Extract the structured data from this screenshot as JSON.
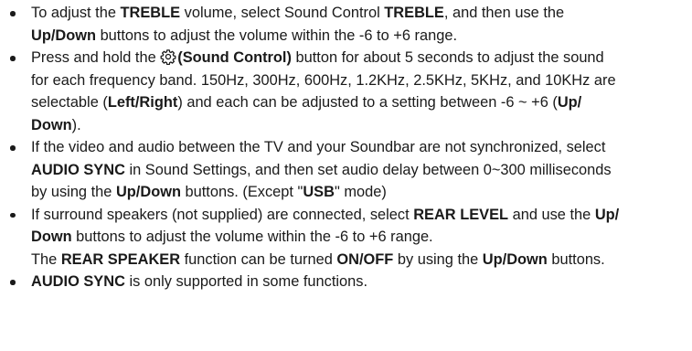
{
  "items": [
    {
      "lines": [
        [
          {
            "t": "To adjust the "
          },
          {
            "t": "TREBLE",
            "b": true
          },
          {
            "t": " volume, select Sound Control "
          },
          {
            "t": "TREBLE",
            "b": true
          },
          {
            "t": ", and then use the"
          }
        ],
        [
          {
            "t": "Up/Down",
            "b": true
          },
          {
            "t": " buttons to adjust the volume within the -6 to +6 range."
          }
        ]
      ]
    },
    {
      "lines": [
        [
          {
            "t": "Press and hold the "
          },
          {
            "icon": "gear-icon"
          },
          {
            "t": "(Sound Control)",
            "b": true
          },
          {
            "t": " button for about 5 seconds to adjust the sound"
          }
        ],
        [
          {
            "t": "for each frequency band. 150Hz, 300Hz, 600Hz, 1.2KHz, 2.5KHz, 5KHz, and 10KHz are"
          }
        ],
        [
          {
            "t": "selectable ("
          },
          {
            "t": "Left/Right",
            "b": true
          },
          {
            "t": ") and each can be adjusted to a setting between -6 ~ +6 ("
          },
          {
            "t": "Up/",
            "b": true
          }
        ],
        [
          {
            "t": "Down",
            "b": true
          },
          {
            "t": ")."
          }
        ]
      ]
    },
    {
      "lines": [
        [
          {
            "t": "If the video and audio between the TV and your Soundbar are not synchronized, select"
          }
        ],
        [
          {
            "t": "AUDIO SYNC",
            "b": true
          },
          {
            "t": " in Sound Settings, and then set audio delay between 0~300 milliseconds"
          }
        ],
        [
          {
            "t": "by using the "
          },
          {
            "t": "Up/Down",
            "b": true
          },
          {
            "t": " buttons. (Except \""
          },
          {
            "t": "USB",
            "b": true
          },
          {
            "t": "\" mode)"
          }
        ]
      ]
    },
    {
      "lines": [
        [
          {
            "t": "If surround speakers (not supplied) are connected, select "
          },
          {
            "t": "REAR LEVEL",
            "b": true
          },
          {
            "t": " and use the "
          },
          {
            "t": "Up/",
            "b": true
          }
        ],
        [
          {
            "t": "Down",
            "b": true
          },
          {
            "t": " buttons to adjust the volume within the -6 to +6 range."
          }
        ],
        [
          {
            "t": "The "
          },
          {
            "t": "REAR SPEAKER",
            "b": true
          },
          {
            "t": " function can be turned "
          },
          {
            "t": "ON/OFF",
            "b": true
          },
          {
            "t": " by using the "
          },
          {
            "t": "Up/Down",
            "b": true
          },
          {
            "t": " buttons."
          }
        ]
      ]
    },
    {
      "lines": [
        [
          {
            "t": "AUDIO SYNC",
            "b": true
          },
          {
            "t": " is only supported in some functions."
          }
        ]
      ]
    }
  ]
}
